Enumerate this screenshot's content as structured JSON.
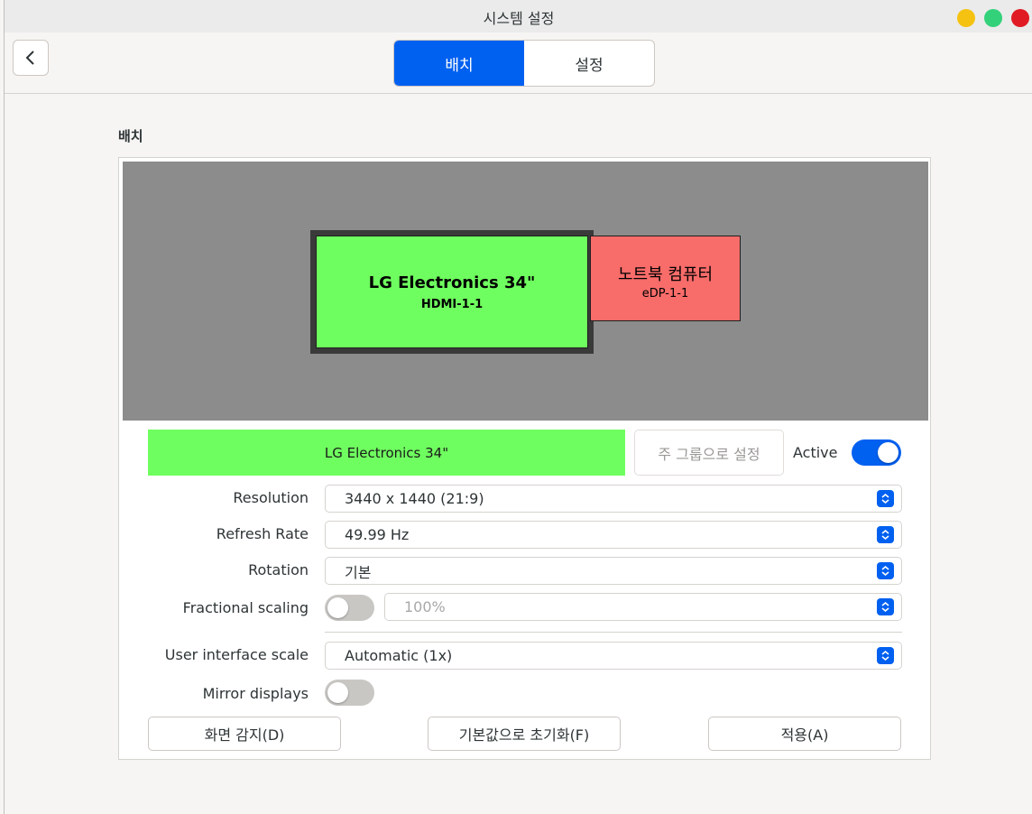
{
  "window": {
    "title": "시스템 설정"
  },
  "header": {
    "tabs": [
      {
        "label": "배치",
        "active": true
      },
      {
        "label": "설정",
        "active": false
      }
    ]
  },
  "section": {
    "title": "배치"
  },
  "arrangement": {
    "monitors": [
      {
        "name": "LG Electronics 34\"",
        "connector": "HDMI-1-1",
        "color": "#6ffe5f",
        "primary": true
      },
      {
        "name": "노트북 컴퓨터",
        "connector": "eDP-1-1",
        "color": "#f86c6a",
        "primary": false
      }
    ]
  },
  "selected_monitor": {
    "name": "LG Electronics 34\"",
    "set_primary_label": "주 그룹으로 설정",
    "active_label": "Active",
    "active": true
  },
  "settings": {
    "resolution": {
      "label": "Resolution",
      "value": "3440 x 1440 (21:9)"
    },
    "refresh_rate": {
      "label": "Refresh Rate",
      "value": "49.99 Hz"
    },
    "rotation": {
      "label": "Rotation",
      "value": "기본"
    },
    "fractional_scaling": {
      "label": "Fractional scaling",
      "enabled": false,
      "value": "100%"
    },
    "ui_scale": {
      "label": "User interface scale",
      "value": "Automatic (1x)"
    },
    "mirror": {
      "label": "Mirror displays",
      "enabled": false
    }
  },
  "buttons": {
    "detect": "화면 감지(D)",
    "reset": "기본값으로 초기화(F)",
    "apply": "적용(A)"
  },
  "colors": {
    "accent": "#0060f0"
  }
}
